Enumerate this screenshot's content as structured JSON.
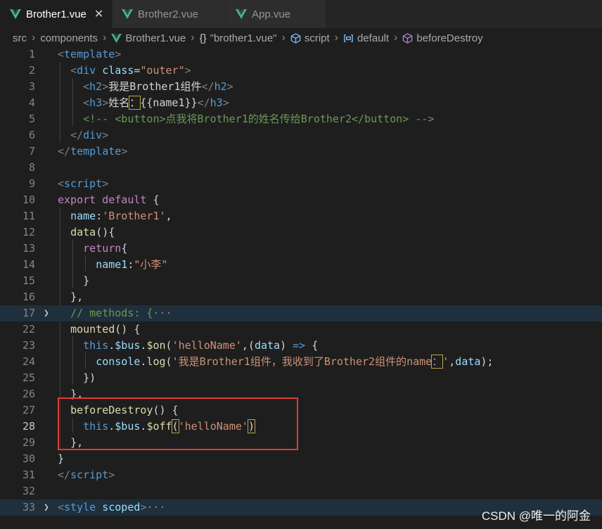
{
  "tabs": [
    {
      "label": "Brother1.vue",
      "active": true
    },
    {
      "label": "Brother2.vue",
      "active": false
    },
    {
      "label": "App.vue",
      "active": false
    }
  ],
  "breadcrumb": {
    "src": "src",
    "components": "components",
    "file": "Brother1.vue",
    "object": "\"brother1.vue\"",
    "script": "script",
    "default": "default",
    "hook": "beforeDestroy"
  },
  "lines": [
    {
      "n": "1",
      "t1": "<",
      "t2": "template",
      "t3": ">"
    },
    {
      "n": "2",
      "t1": "<",
      "t2": "div",
      "t3": "class",
      "t4": "=",
      "t5": "\"outer\"",
      "t6": ">"
    },
    {
      "n": "3",
      "t1": "<",
      "t2": "h2",
      "t3": ">",
      "t4": "我是Brother1组件",
      "t5": "</",
      "t6": "h2",
      "t7": ">"
    },
    {
      "n": "4",
      "t1": "<",
      "t2": "h3",
      "t3": ">",
      "t4": "姓名",
      "t5": "：",
      "t6": "{{name1}}",
      "t7": "</",
      "t8": "h3",
      "t9": ">"
    },
    {
      "n": "5",
      "t1": "<!-- <button>点我将Brother1的姓名传给Brother2</button> -->"
    },
    {
      "n": "6",
      "t1": "</",
      "t2": "div",
      "t3": ">"
    },
    {
      "n": "7",
      "t1": "</",
      "t2": "template",
      "t3": ">"
    },
    {
      "n": "8"
    },
    {
      "n": "9",
      "t1": "<",
      "t2": "script",
      "t3": ">"
    },
    {
      "n": "10",
      "t1": "export",
      "t2": "default",
      "t3": "{"
    },
    {
      "n": "11",
      "t1": "name",
      "t2": ":",
      "t3": "'Brother1'",
      "t4": ","
    },
    {
      "n": "12",
      "t1": "data",
      "t2": "(){"
    },
    {
      "n": "13",
      "t1": "return",
      "t2": "{"
    },
    {
      "n": "14",
      "t1": "name1",
      "t2": ":",
      "t3": "\"小李\""
    },
    {
      "n": "15",
      "t1": "}"
    },
    {
      "n": "16",
      "t1": "},"
    },
    {
      "n": "17",
      "t1": "// methods: {",
      "t2": "···"
    },
    {
      "n": "22",
      "t1": "mounted",
      "t2": "() {"
    },
    {
      "n": "23",
      "t1": "this",
      "t2": ".",
      "t3": "$bus",
      "t4": ".",
      "t5": "$on",
      "t6": "(",
      "t7": "'helloName'",
      "t8": ",(",
      "t9": "data",
      "t10": ") ",
      "t11": "=>",
      "t12": " {"
    },
    {
      "n": "24",
      "t1": "console",
      "t2": ".",
      "t3": "log",
      "t4": "(",
      "t5": "'我是Brother1组件，我收到了Brother2组件的name",
      "t6": "：",
      "t7": "'",
      "t8": ",",
      "t9": "data",
      "t10": ");"
    },
    {
      "n": "25",
      "t1": "})"
    },
    {
      "n": "26",
      "t1": "},"
    },
    {
      "n": "27",
      "t1": "beforeDestroy",
      "t2": "() {"
    },
    {
      "n": "28",
      "t1": "this",
      "t2": ".",
      "t3": "$bus",
      "t4": ".",
      "t5": "$off",
      "t6": "(",
      "t7": "'helloName'",
      "t8": ")"
    },
    {
      "n": "29",
      "t1": "},"
    },
    {
      "n": "30",
      "t1": "}"
    },
    {
      "n": "31",
      "t1": "</",
      "t2": "script",
      "t3": ">"
    },
    {
      "n": "32"
    },
    {
      "n": "33",
      "t1": "<",
      "t2": "style",
      "t3": "scoped",
      "t4": ">",
      "t5": "···"
    }
  ],
  "watermark": "CSDN @唯一的阿金",
  "colors": {
    "vue_green": "#42b883",
    "highlight_box": "#e53a3a"
  }
}
